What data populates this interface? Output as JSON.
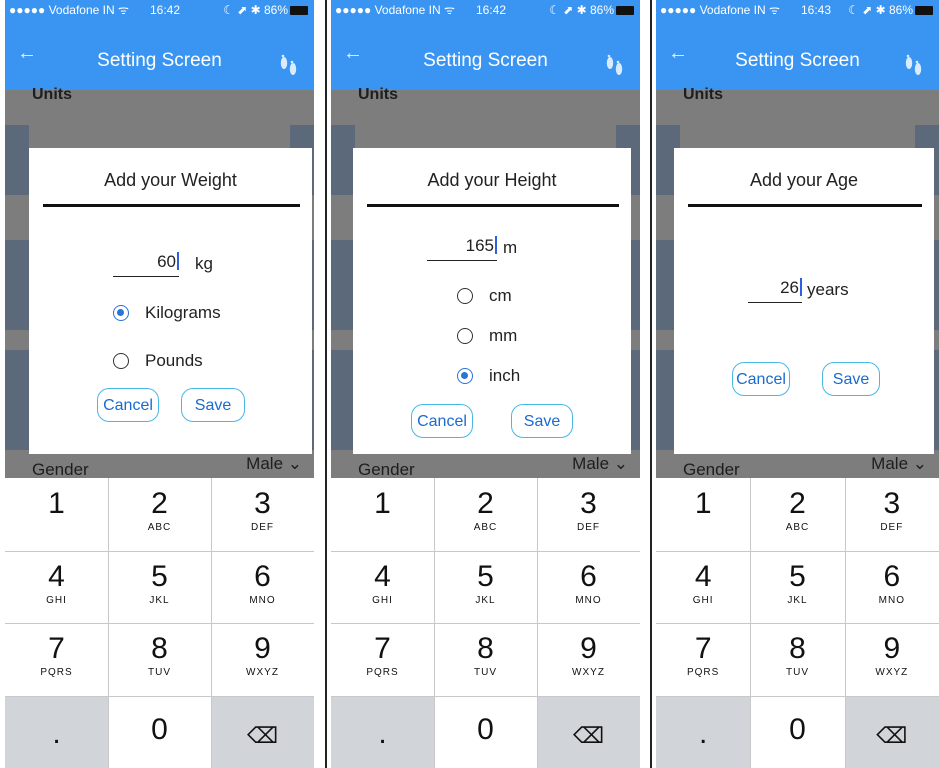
{
  "screens": [
    {
      "status": {
        "carrier": "●●●●● Vodafone IN ᯤ",
        "time": "16:42",
        "right": "☾ ⬈ ✱ 86%"
      },
      "nav": {
        "title": "Setting Screen",
        "back": "←"
      },
      "bg": {
        "section": "Units",
        "gender_label": "Gender",
        "gender_value": "Male ⌄"
      },
      "dialog": {
        "title": "Add your Weight",
        "value": "60",
        "unit": "kg",
        "options": [
          {
            "label": "Kilograms",
            "selected": true
          },
          {
            "label": "Pounds",
            "selected": false
          }
        ],
        "cancel": "Cancel",
        "save": "Save"
      }
    },
    {
      "status": {
        "carrier": "●●●●● Vodafone IN ᯤ",
        "time": "16:42",
        "right": "☾ ⬈ ✱ 86%"
      },
      "nav": {
        "title": "Setting Screen",
        "back": "←"
      },
      "bg": {
        "section": "Units",
        "gender_label": "Gender",
        "gender_value": "Male ⌄"
      },
      "dialog": {
        "title": "Add your Height",
        "value": "165",
        "unit": "m",
        "options": [
          {
            "label": "cm",
            "selected": false
          },
          {
            "label": "mm",
            "selected": false
          },
          {
            "label": "inch",
            "selected": true
          }
        ],
        "cancel": "Cancel",
        "save": "Save"
      }
    },
    {
      "status": {
        "carrier": "●●●●● Vodafone IN ᯤ",
        "time": "16:43",
        "right": "☾ ⬈ ✱ 86%"
      },
      "nav": {
        "title": "Setting Screen",
        "back": "←"
      },
      "bg": {
        "section": "Units",
        "gender_label": "Gender",
        "gender_value": "Male ⌄"
      },
      "dialog": {
        "title": "Add your Age",
        "value": "26",
        "unit": "years",
        "options": [],
        "cancel": "Cancel",
        "save": "Save"
      }
    }
  ],
  "keypad": {
    "keys": [
      {
        "digit": "1",
        "letters": ""
      },
      {
        "digit": "2",
        "letters": "ABC"
      },
      {
        "digit": "3",
        "letters": "DEF"
      },
      {
        "digit": "4",
        "letters": "GHI"
      },
      {
        "digit": "5",
        "letters": "JKL"
      },
      {
        "digit": "6",
        "letters": "MNO"
      },
      {
        "digit": "7",
        "letters": "PQRS"
      },
      {
        "digit": "8",
        "letters": "TUV"
      },
      {
        "digit": "9",
        "letters": "WXYZ"
      },
      {
        "digit": ".",
        "letters": ""
      },
      {
        "digit": "0",
        "letters": ""
      },
      {
        "digit": "⌫",
        "letters": ""
      }
    ]
  },
  "colors": {
    "nav_blue": "#3a95f2",
    "button_border": "#49b7e6",
    "radio_selected": "#2a73d9",
    "caret": "#2c5fe6"
  }
}
